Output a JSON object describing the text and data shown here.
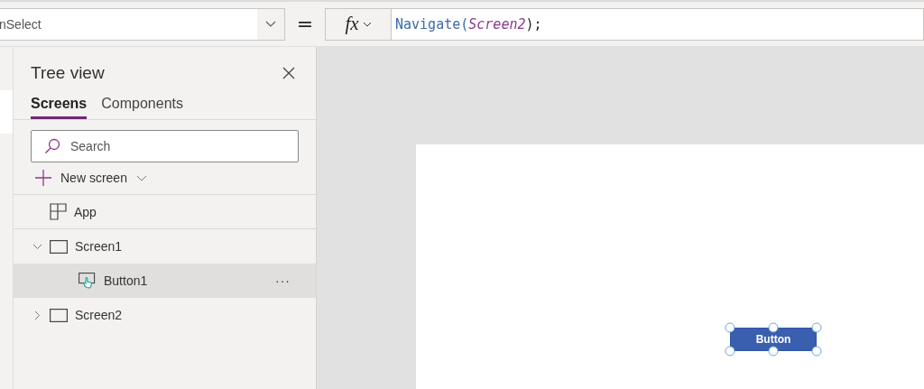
{
  "formula_bar": {
    "property": "nSelect",
    "equals": "=",
    "fx": "fx",
    "formula": [
      {
        "kind": "function",
        "text": "Navigate("
      },
      {
        "kind": "argument",
        "text": "Screen2"
      },
      {
        "kind": "function",
        "text": ");"
      }
    ]
  },
  "tree_view": {
    "title": "Tree view",
    "tabs": [
      {
        "label": "Screens",
        "selected": true
      },
      {
        "label": "Components",
        "selected": false
      }
    ],
    "search": {
      "placeholder": "Search"
    },
    "new_screen": "New screen",
    "items": [
      {
        "kind": "app",
        "label": "App",
        "selected": false
      },
      {
        "kind": "screen",
        "label": "Screen1",
        "expanded": true,
        "selected": false,
        "children": [
          {
            "kind": "button",
            "label": "Button1",
            "selected": true,
            "more": "···"
          }
        ]
      },
      {
        "kind": "screen",
        "label": "Screen2",
        "expanded": false,
        "selected": false
      }
    ]
  },
  "canvas": {
    "button": {
      "label": "Button",
      "selected": true
    }
  }
}
